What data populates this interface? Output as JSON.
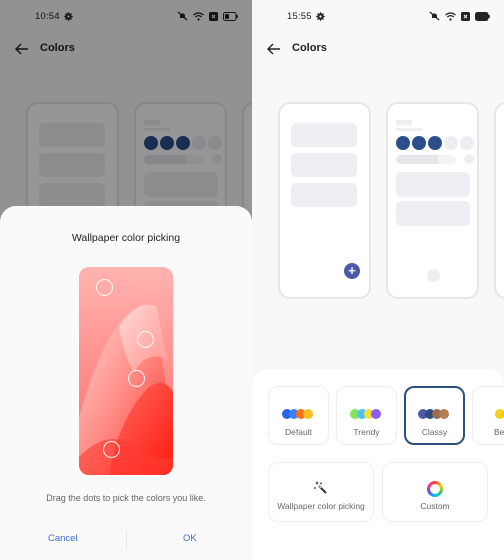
{
  "left_screen": {
    "status": {
      "time": "10:54"
    },
    "appbar": {
      "title": "Colors"
    },
    "dialog": {
      "title": "Wallpaper color picking",
      "hint": "Drag the dots to pick the colors you like.",
      "cancel_label": "Cancel",
      "ok_label": "OK",
      "picker_dot_count": 4
    }
  },
  "right_screen": {
    "status": {
      "time": "15:55"
    },
    "appbar": {
      "title": "Colors"
    },
    "preview_accent": "#2c4f8a",
    "fab_color": "#4a5aa8",
    "fab_symbol": "+",
    "palettes": [
      {
        "label": "Default",
        "colors": [
          "#2563eb",
          "#3b82f6",
          "#f97316",
          "#fbbf24"
        ],
        "selected": false
      },
      {
        "label": "Trendy",
        "colors": [
          "#86e45a",
          "#4cc3f5",
          "#f5e03a",
          "#8b5cf6"
        ],
        "selected": false
      },
      {
        "label": "Classy",
        "colors": [
          "#4a5aa8",
          "#2c4f7e",
          "#9a6a4a",
          "#b08058"
        ],
        "selected": true
      },
      {
        "label": "Beyond",
        "colors": [
          "#f5d020",
          "#f5c020"
        ],
        "selected": false
      }
    ],
    "options": [
      {
        "label": "Wallpaper color picking",
        "icon": "magic-wand-icon"
      },
      {
        "label": "Custom",
        "icon": "color-ring-icon"
      }
    ]
  }
}
